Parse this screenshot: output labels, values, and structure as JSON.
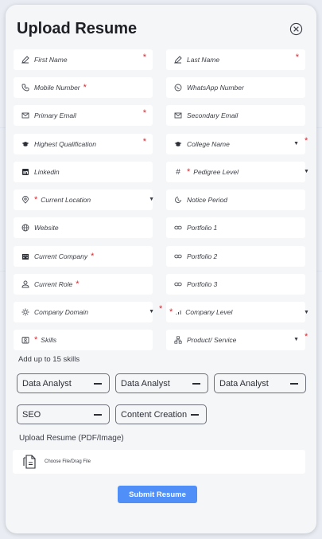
{
  "title": "Upload Resume",
  "fields": {
    "first_name": "First Name",
    "last_name": "Last Name",
    "mobile": "Mobile Number",
    "whatsapp": "WhatsApp Number",
    "primary_email": "Primary Email",
    "secondary_email": "Secondary Email",
    "qualification": "Highest Qualification",
    "college": "College Name",
    "linkedin": "Linkedin",
    "pedigree": "Pedigree Level",
    "location": "Current Location",
    "notice": "Notice Period",
    "website": "Website",
    "portfolio1": "Portfolio 1",
    "company": "Current Company",
    "portfolio2": "Portfolio 2",
    "role": "Current Role",
    "portfolio3": "Portfolio 3",
    "domain": "Company Domain",
    "company_level": "Company  Level",
    "skills": "Skills",
    "product": "Product/ Service"
  },
  "skills_hint": "Add up to 15 skills",
  "skills": [
    "Data Analyst",
    "Data Analyst",
    "Data Analyst",
    "SEO",
    "Content Creation"
  ],
  "upload_label": "Upload Resume (PDF/Image)",
  "upload_placeholder": "Choose File/Drag File",
  "submit_label": "Submit Resume",
  "required_mark": "*",
  "colors": {
    "accent": "#4f8ff7",
    "required": "#e0242d",
    "modal_bg": "#f5f6f8"
  },
  "icons": {
    "first_name": "pen-icon",
    "last_name": "pen-icon",
    "mobile": "phone-icon",
    "whatsapp": "whatsapp-icon",
    "primary_email": "mail-icon",
    "secondary_email": "mail-icon",
    "qualification": "graduation-cap-icon",
    "college": "graduation-cap-icon",
    "linkedin": "linkedin-icon",
    "pedigree": "hash-icon",
    "location": "location-pin-icon",
    "notice": "clock-icon",
    "website": "globe-icon",
    "portfolio": "link-icon",
    "company": "building-icon",
    "role": "user-icon",
    "domain": "sun-icon",
    "company_level": "signal-icon",
    "skills": "badge-icon",
    "product": "hierarchy-icon",
    "upload": "file-icon",
    "close": "close-circle-icon"
  }
}
